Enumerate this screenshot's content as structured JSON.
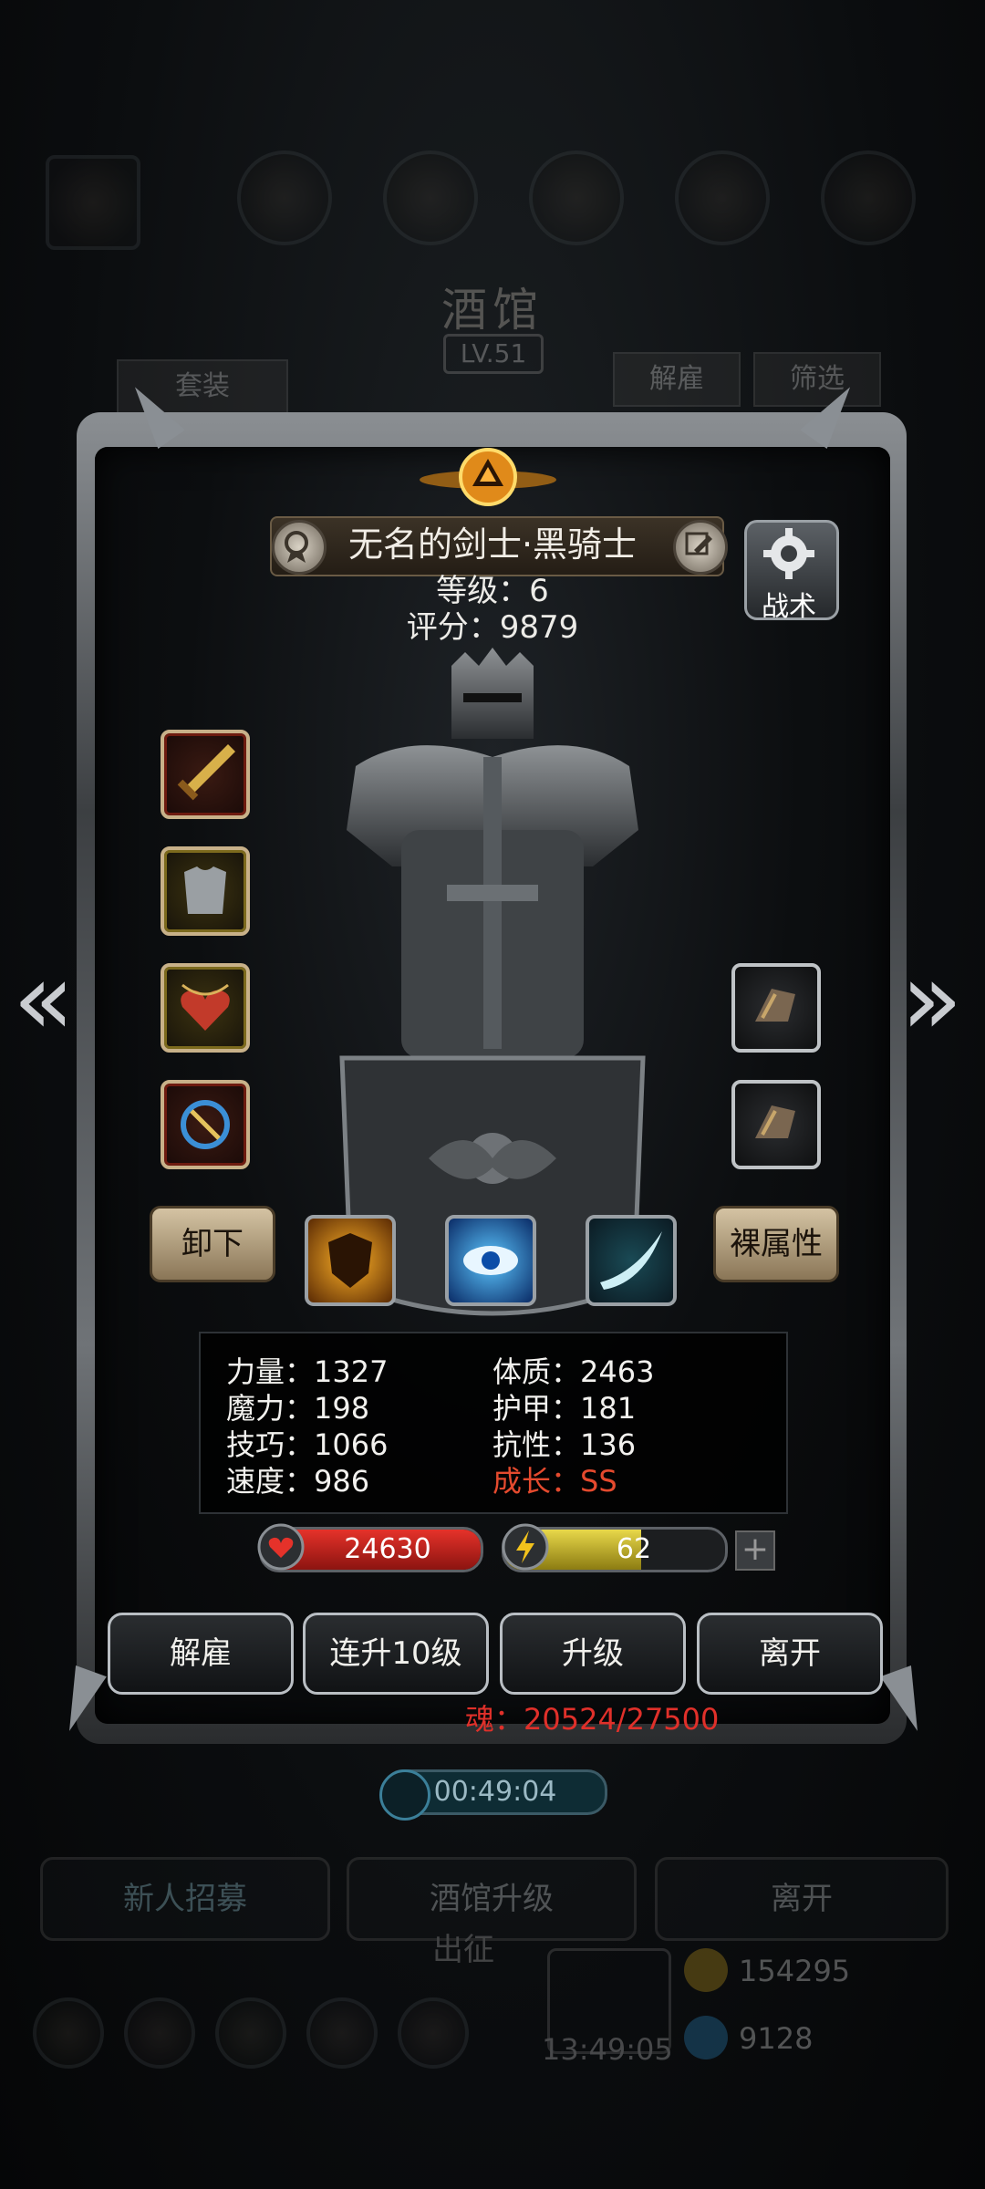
{
  "background": {
    "title": "酒馆",
    "level": "LV.51",
    "set_label": "套装",
    "dismiss_label": "解雇",
    "filter_label": "筛选",
    "timer": "00:49:04",
    "bottom_buttons": [
      "新人招募",
      "酒馆升级",
      "离开"
    ],
    "depart_label": "出征",
    "gold": "154295",
    "gems": "9128",
    "clock": "13:49:05"
  },
  "hero": {
    "name": "无名的剑士·黑骑士",
    "level_label": "等级：6",
    "score_label": "评分：9879",
    "tactics_label": "战术"
  },
  "buttons": {
    "unequip": "卸下",
    "naked_stats": "裸属性"
  },
  "stats": {
    "strength": "力量：1327",
    "magic": "魔力：198",
    "skill": "技巧：1066",
    "speed": "速度：986",
    "constitution": "体质：2463",
    "armor": "护甲：181",
    "resistance": "抗性：136",
    "growth": "成长：SS"
  },
  "bars": {
    "hp": "24630",
    "energy": "62",
    "energy_fraction": 0.62
  },
  "actions": [
    "解雇",
    "连升10级",
    "升级",
    "离开"
  ],
  "soul": "魂：20524/27500",
  "icons": {
    "weapon": "sword-icon",
    "armor": "armor-icon",
    "accessory": "heart-necklace-icon",
    "offhand": "magic-shield-icon",
    "ring1": "gauntlet-icon",
    "ring2": "gauntlet-icon",
    "skill1": "fire-shield-icon",
    "skill2": "eye-icon",
    "skill3": "slash-icon"
  }
}
